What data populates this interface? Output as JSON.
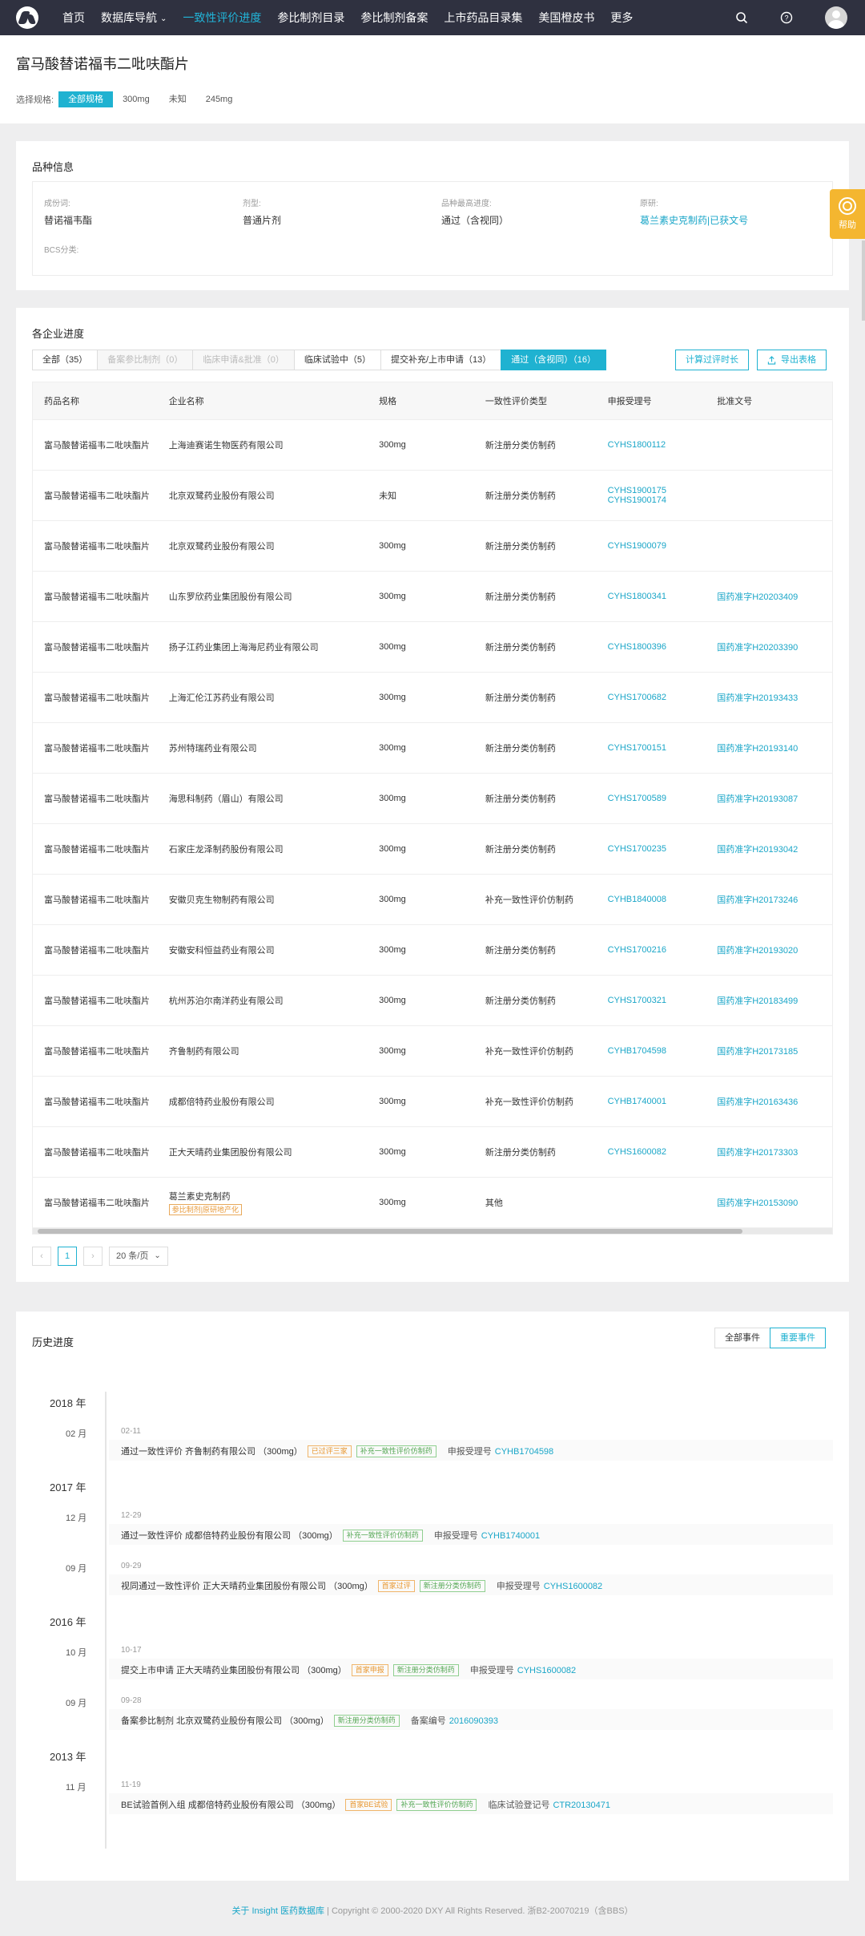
{
  "nav": {
    "items": [
      "首页",
      "数据库导航",
      "一致性评价进度",
      "参比制剂目录",
      "参比制剂备案",
      "上市药品目录集",
      "美国橙皮书",
      "更多"
    ],
    "active_index": 2,
    "dropdown_index": 1
  },
  "page": {
    "title": "富马酸替诺福韦二吡呋酯片",
    "spec_label": "选择规格:",
    "spec_options": [
      "全部规格",
      "300mg",
      "未知",
      "245mg"
    ],
    "spec_active": 0
  },
  "variety": {
    "title": "品种信息",
    "fields": [
      {
        "label": "成份词:",
        "value": "替诺福韦酯"
      },
      {
        "label": "剂型:",
        "value": "普通片剂"
      },
      {
        "label": "品种最高进度:",
        "value": "通过（含视同）"
      },
      {
        "label": "原研:",
        "value": "葛兰素史克制药|已获文号"
      },
      {
        "label": "BCS分类:",
        "value": ""
      }
    ]
  },
  "progress": {
    "title": "各企业进度",
    "tabs": [
      {
        "label": "全部（35）",
        "state": "normal"
      },
      {
        "label": "备案参比制剂（0）",
        "state": "disabled"
      },
      {
        "label": "临床申请&批准（0）",
        "state": "disabled"
      },
      {
        "label": "临床试验中（5）",
        "state": "normal"
      },
      {
        "label": "提交补充/上市申请（13）",
        "state": "normal"
      },
      {
        "label": "通过（含视同）（16）",
        "state": "active"
      }
    ],
    "calc_button": "计算过评时长",
    "export_button": "导出表格",
    "columns": [
      "药品名称",
      "企业名称",
      "规格",
      "一致性评价类型",
      "申报受理号",
      "批准文号"
    ],
    "rows": [
      {
        "drug": "富马酸替诺福韦二吡呋酯片",
        "company": "上海迪赛诺生物医药有限公司",
        "spec": "300mg",
        "type": "新注册分类仿制药",
        "accept": [
          "CYHS1800112"
        ],
        "approval": ""
      },
      {
        "drug": "富马酸替诺福韦二吡呋酯片",
        "company": "北京双鹭药业股份有限公司",
        "spec": "未知",
        "type": "新注册分类仿制药",
        "accept": [
          "CYHS1900175",
          "CYHS1900174"
        ],
        "approval": ""
      },
      {
        "drug": "富马酸替诺福韦二吡呋酯片",
        "company": "北京双鹭药业股份有限公司",
        "spec": "300mg",
        "type": "新注册分类仿制药",
        "accept": [
          "CYHS1900079"
        ],
        "approval": ""
      },
      {
        "drug": "富马酸替诺福韦二吡呋酯片",
        "company": "山东罗欣药业集团股份有限公司",
        "spec": "300mg",
        "type": "新注册分类仿制药",
        "accept": [
          "CYHS1800341"
        ],
        "approval": "国药准字H20203409"
      },
      {
        "drug": "富马酸替诺福韦二吡呋酯片",
        "company": "扬子江药业集团上海海尼药业有限公司",
        "spec": "300mg",
        "type": "新注册分类仿制药",
        "accept": [
          "CYHS1800396"
        ],
        "approval": "国药准字H20203390"
      },
      {
        "drug": "富马酸替诺福韦二吡呋酯片",
        "company": "上海汇伦江苏药业有限公司",
        "spec": "300mg",
        "type": "新注册分类仿制药",
        "accept": [
          "CYHS1700682"
        ],
        "approval": "国药准字H20193433"
      },
      {
        "drug": "富马酸替诺福韦二吡呋酯片",
        "company": "苏州特瑞药业有限公司",
        "spec": "300mg",
        "type": "新注册分类仿制药",
        "accept": [
          "CYHS1700151"
        ],
        "approval": "国药准字H20193140"
      },
      {
        "drug": "富马酸替诺福韦二吡呋酯片",
        "company": "海思科制药（眉山）有限公司",
        "spec": "300mg",
        "type": "新注册分类仿制药",
        "accept": [
          "CYHS1700589"
        ],
        "approval": "国药准字H20193087"
      },
      {
        "drug": "富马酸替诺福韦二吡呋酯片",
        "company": "石家庄龙泽制药股份有限公司",
        "spec": "300mg",
        "type": "新注册分类仿制药",
        "accept": [
          "CYHS1700235"
        ],
        "approval": "国药准字H20193042"
      },
      {
        "drug": "富马酸替诺福韦二吡呋酯片",
        "company": "安徽贝克生物制药有限公司",
        "spec": "300mg",
        "type": "补充一致性评价仿制药",
        "accept": [
          "CYHB1840008"
        ],
        "approval": "国药准字H20173246"
      },
      {
        "drug": "富马酸替诺福韦二吡呋酯片",
        "company": "安徽安科恒益药业有限公司",
        "spec": "300mg",
        "type": "新注册分类仿制药",
        "accept": [
          "CYHS1700216"
        ],
        "approval": "国药准字H20193020"
      },
      {
        "drug": "富马酸替诺福韦二吡呋酯片",
        "company": "杭州苏泊尔南洋药业有限公司",
        "spec": "300mg",
        "type": "新注册分类仿制药",
        "accept": [
          "CYHS1700321"
        ],
        "approval": "国药准字H20183499"
      },
      {
        "drug": "富马酸替诺福韦二吡呋酯片",
        "company": "齐鲁制药有限公司",
        "spec": "300mg",
        "type": "补充一致性评价仿制药",
        "accept": [
          "CYHB1704598"
        ],
        "approval": "国药准字H20173185"
      },
      {
        "drug": "富马酸替诺福韦二吡呋酯片",
        "company": "成都倍特药业股份有限公司",
        "spec": "300mg",
        "type": "补充一致性评价仿制药",
        "accept": [
          "CYHB1740001"
        ],
        "approval": "国药准字H20163436"
      },
      {
        "drug": "富马酸替诺福韦二吡呋酯片",
        "company": "正大天晴药业集团股份有限公司",
        "spec": "300mg",
        "type": "新注册分类仿制药",
        "accept": [
          "CYHS1600082"
        ],
        "approval": "国药准字H20173303"
      },
      {
        "drug": "富马酸替诺福韦二吡呋酯片",
        "company": "葛兰素史克制药",
        "company_tag": "参比制剂|原研地产化",
        "spec": "300mg",
        "type": "其他",
        "accept": [],
        "approval": "国药准字H20153090"
      }
    ],
    "pager": {
      "prev": "‹",
      "page": "1",
      "next": "›",
      "size": "20 条/页"
    }
  },
  "history": {
    "title": "历史进度",
    "toggle": [
      "全部事件",
      "重要事件"
    ],
    "toggle_active": 1,
    "groups": [
      {
        "year": "2018 年",
        "events": [
          {
            "month": "02 月",
            "date": "02-11",
            "text": "通过一致性评价 齐鲁制药有限公司 （300mg）",
            "tags": [
              {
                "t": "已过评三家",
                "c": "orange"
              },
              {
                "t": "补充一致性评价仿制药",
                "c": "green"
              }
            ],
            "meta_label": "申报受理号",
            "meta_value": "CYHB1704598"
          }
        ]
      },
      {
        "year": "2017 年",
        "events": [
          {
            "month": "12 月",
            "date": "12-29",
            "text": "通过一致性评价 成都倍特药业股份有限公司 （300mg）",
            "tags": [
              {
                "t": "补充一致性评价仿制药",
                "c": "green"
              }
            ],
            "meta_label": "申报受理号",
            "meta_value": "CYHB1740001"
          },
          {
            "month": "09 月",
            "date": "09-29",
            "text": "视同通过一致性评价 正大天晴药业集团股份有限公司 （300mg）",
            "tags": [
              {
                "t": "首家过评",
                "c": "orange"
              },
              {
                "t": "新注册分类仿制药",
                "c": "green"
              }
            ],
            "meta_label": "申报受理号",
            "meta_value": "CYHS1600082"
          }
        ]
      },
      {
        "year": "2016 年",
        "events": [
          {
            "month": "10 月",
            "date": "10-17",
            "text": "提交上市申请 正大天晴药业集团股份有限公司 （300mg）",
            "tags": [
              {
                "t": "首家申报",
                "c": "orange"
              },
              {
                "t": "新注册分类仿制药",
                "c": "green"
              }
            ],
            "meta_label": "申报受理号",
            "meta_value": "CYHS1600082"
          },
          {
            "month": "09 月",
            "date": "09-28",
            "text": "备案参比制剂 北京双鹭药业股份有限公司 （300mg）",
            "tags": [
              {
                "t": "新注册分类仿制药",
                "c": "green"
              }
            ],
            "meta_label": "备案编号",
            "meta_value": "2016090393"
          }
        ]
      },
      {
        "year": "2013 年",
        "events": [
          {
            "month": "11 月",
            "date": "11-19",
            "text": "BE试验首例入组 成都倍特药业股份有限公司 （300mg）",
            "tags": [
              {
                "t": "首家BE试验",
                "c": "orange"
              },
              {
                "t": "补充一致性评价仿制药",
                "c": "green"
              }
            ],
            "meta_label": "临床试验登记号",
            "meta_value": "CTR20130471"
          }
        ]
      }
    ]
  },
  "help": {
    "label": "帮助"
  },
  "footer": {
    "link": "关于 Insight 医药数据库",
    "text": " | Copyright © 2000-2020 DXY All Rights Reserved. 浙B2-20070219（含BBS）"
  },
  "colors": {
    "accent": "#1fb2d1",
    "nav_bg": "#2f3140",
    "help": "#f4b630"
  },
  "icons": {
    "logo": "dxy-logo-icon",
    "search": "search-icon",
    "help": "question-circle-icon",
    "user": "avatar-icon"
  }
}
